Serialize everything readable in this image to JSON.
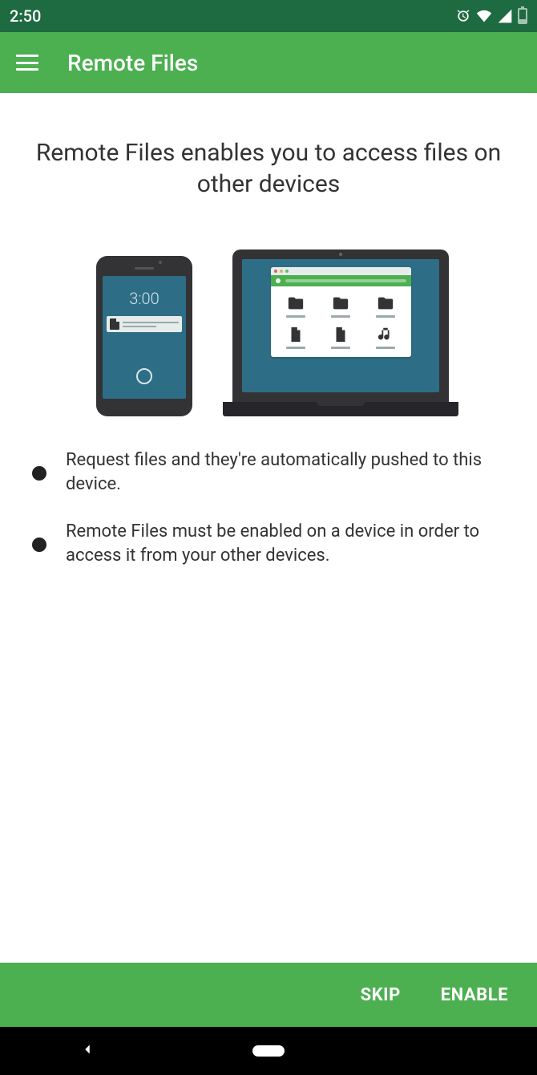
{
  "statusbar": {
    "time": "2:50"
  },
  "appbar": {
    "title": "Remote Files"
  },
  "page": {
    "headline": "Remote Files enables you to access files on other devices",
    "illustration": {
      "phone_time": "3:00"
    },
    "bullets": [
      "Request files and they're automatically pushed to this device.",
      "Remote Files must be enabled on a device in order to access it from your other devices."
    ]
  },
  "actions": {
    "skip": "SKIP",
    "enable": "ENABLE"
  }
}
